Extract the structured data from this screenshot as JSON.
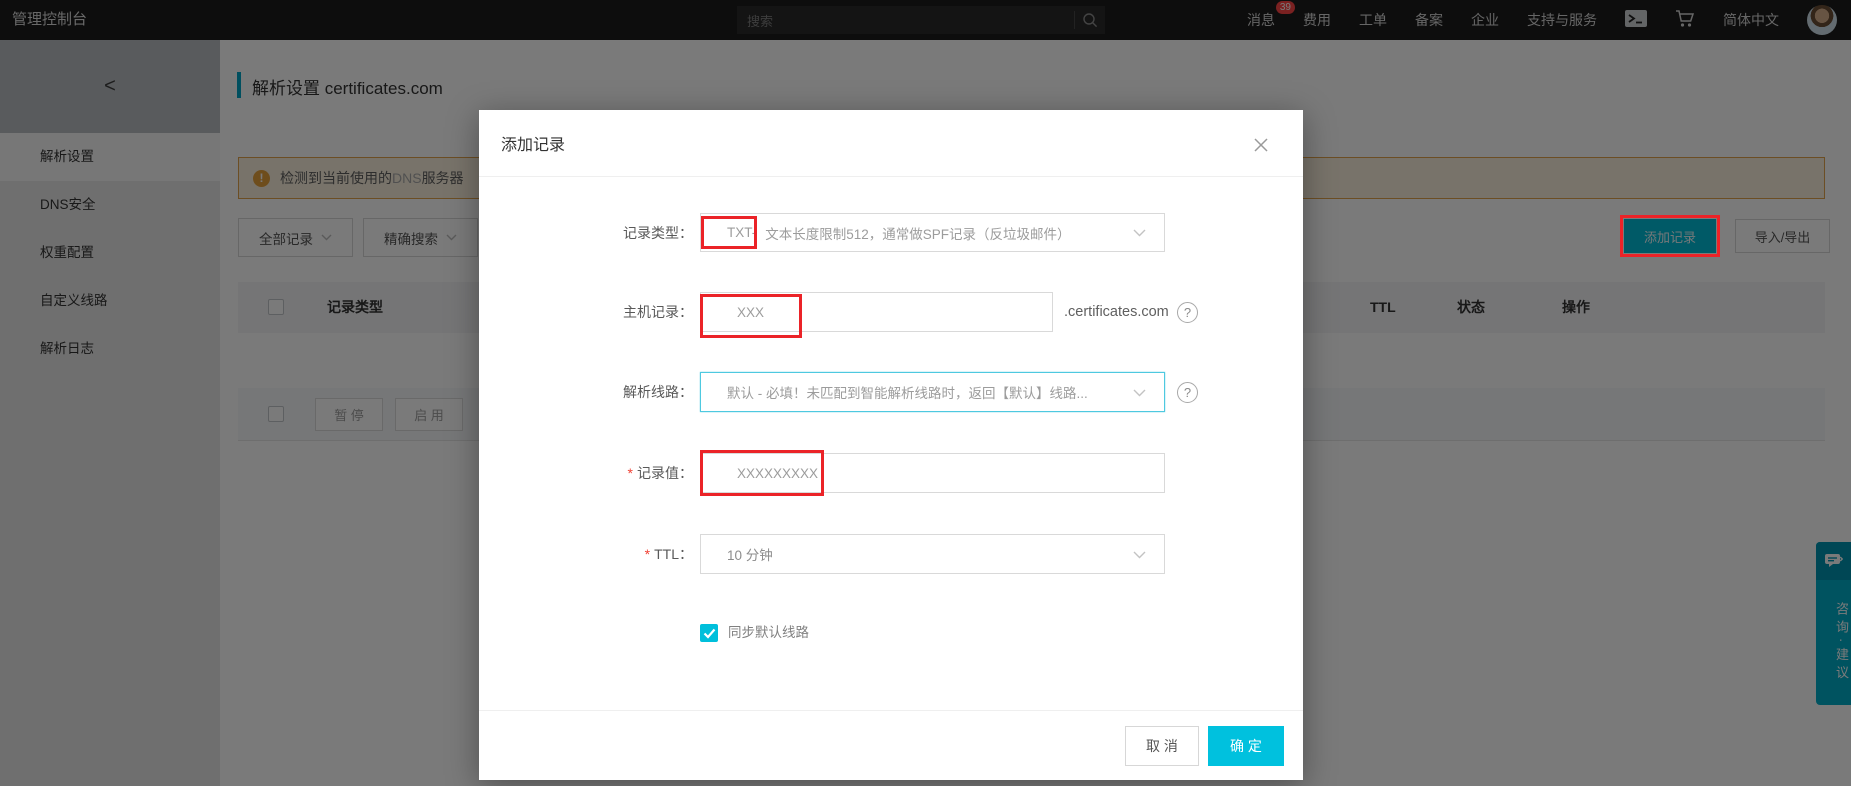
{
  "topnav": {
    "brand": "管理控制台",
    "search_placeholder": "搜索",
    "items": [
      {
        "label": "消息",
        "badge": "39"
      },
      {
        "label": "费用"
      },
      {
        "label": "工单"
      },
      {
        "label": "备案"
      },
      {
        "label": "企业"
      },
      {
        "label": "支持与服务"
      }
    ],
    "language": "简体中文"
  },
  "sidebar": {
    "collapse_glyph": "<",
    "items": [
      {
        "label": "解析设置",
        "active": true
      },
      {
        "label": "DNS安全"
      },
      {
        "label": "权重配置"
      },
      {
        "label": "自定义线路"
      },
      {
        "label": "解析日志"
      }
    ]
  },
  "page": {
    "title": "解析设置 certificates.com",
    "banner": {
      "icon_glyph": "!",
      "text_prefix": "检测到当前使用的",
      "text_code": "DNS",
      "text_suffix": "服务器"
    },
    "filters": {
      "record_type": "全部记录",
      "search_mode": "精确搜索"
    },
    "actions": {
      "add": "添加记录",
      "import_export": "导入/导出"
    },
    "table": {
      "col_record_type": "记录类型",
      "col_ttl": "TTL",
      "col_status": "状态",
      "col_action": "操作"
    },
    "batch": {
      "pause": "暂 停",
      "enable": "启 用"
    }
  },
  "side_tab": {
    "label": "咨询·建议"
  },
  "modal": {
    "title": "添加记录",
    "type_row": {
      "label": "记录类型：",
      "highlight": "TXT-",
      "rest": "文本长度限制512，通常做SPF记录（反垃圾邮件）"
    },
    "host_row": {
      "label": "主机记录：",
      "value": "XXX",
      "suffix": ".certificates.com",
      "help_glyph": "?"
    },
    "line_row": {
      "label": "解析线路：",
      "value": "默认 - 必填！未匹配到智能解析线路时，返回【默认】线路...",
      "help_glyph": "?"
    },
    "value_row": {
      "required": "*",
      "label": "记录值：",
      "value": "XXXXXXXXX"
    },
    "ttl_row": {
      "required": "*",
      "label": "TTL：",
      "value": "10 分钟"
    },
    "sync_row": {
      "label": "同步默认线路",
      "checked": true
    },
    "footer": {
      "cancel": "取 消",
      "confirm": "确 定"
    }
  },
  "colors": {
    "accent_cyan": "#00C1DE",
    "annotation_red": "#EB2328",
    "warning_orange": "#E6A23C",
    "badge_red": "#FF4545",
    "focus_border": "#4EC9E0"
  }
}
